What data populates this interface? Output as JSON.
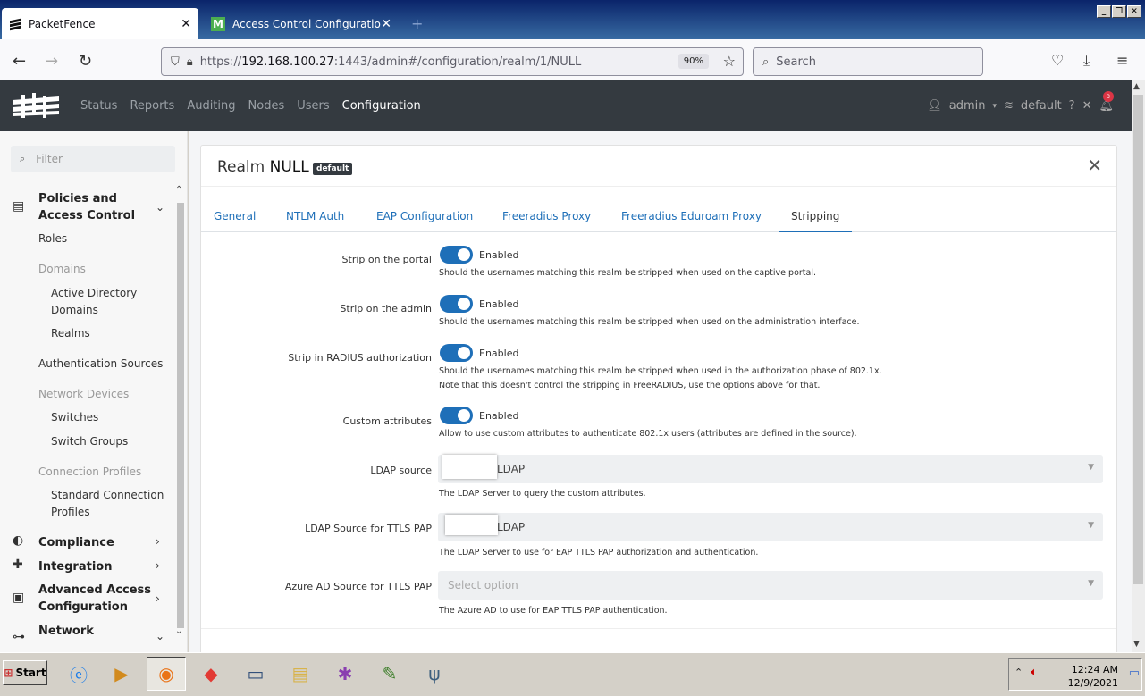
{
  "browser": {
    "tabs": [
      {
        "title": "PacketFence",
        "active": true
      },
      {
        "title": "Access Control Configuration - Mer",
        "active": false
      }
    ],
    "new_tab": "+",
    "url_prefix": "https://",
    "url_host": "192.168.100.27",
    "url_rest": ":1443/admin#/configuration/realm/1/NULL",
    "zoom": "90%",
    "search_placeholder": "Search"
  },
  "app": {
    "nav": [
      "Status",
      "Reports",
      "Auditing",
      "Nodes",
      "Users",
      "Configuration"
    ],
    "active_nav": "Configuration",
    "user": "admin",
    "tenant": "default",
    "notification_count": "3"
  },
  "sidebar": {
    "filter_placeholder": "Filter",
    "policies_group": "Policies and Access Control",
    "roles": "Roles",
    "domains_header": "Domains",
    "active_directory_domains": "Active Directory Domains",
    "realms": "Realms",
    "authentication_sources": "Authentication Sources",
    "network_devices_header": "Network Devices",
    "switches": "Switches",
    "switch_groups": "Switch Groups",
    "connection_profiles_header": "Connection Profiles",
    "standard_connection_profiles": "Standard Connection Profiles",
    "compliance": "Compliance",
    "integration": "Integration",
    "advanced_access_configuration": "Advanced Access Configuration",
    "network": "Network"
  },
  "realm": {
    "title_prefix": "Realm",
    "title_name": "NULL",
    "badge": "default",
    "tabs": [
      "General",
      "NTLM Auth",
      "EAP Configuration",
      "Freeradius Proxy",
      "Freeradius Eduroam Proxy",
      "Stripping"
    ],
    "active_tab": "Stripping",
    "fields": {
      "strip_portal": {
        "label": "Strip on the portal",
        "state": "Enabled",
        "help": "Should the usernames matching this realm be stripped when used on the captive portal."
      },
      "strip_admin": {
        "label": "Strip on the admin",
        "state": "Enabled",
        "help": "Should the usernames matching this realm be stripped when used on the administration interface."
      },
      "strip_radius": {
        "label": "Strip in RADIUS authorization",
        "state": "Enabled",
        "help": "Should the usernames matching this realm be stripped when used in the authorization phase of 802.1x.",
        "help2": "Note that this doesn't control the stripping in FreeRADIUS, use the options above for that."
      },
      "custom_attributes": {
        "label": "Custom attributes",
        "state": "Enabled",
        "help": "Allow to use custom attributes to authenticate 802.1x users (attributes are defined in the source)."
      },
      "ldap_source": {
        "label": "LDAP source",
        "value": "LDAP",
        "help": "The LDAP Server to query the custom attributes."
      },
      "ldap_ttls": {
        "label": "LDAP Source for TTLS PAP",
        "value": "LDAP",
        "help": "The LDAP Server to use for EAP TTLS PAP authorization and authentication."
      },
      "azure_ttls": {
        "label": "Azure AD Source for TTLS PAP",
        "placeholder": "Select option",
        "help": "The Azure AD to use for EAP TTLS PAP authentication."
      }
    }
  },
  "taskbar": {
    "start": "Start",
    "time": "12:24 AM",
    "date": "12/9/2021"
  },
  "colors": {
    "accent": "#1e6fb8",
    "header_bg": "#343a40"
  }
}
